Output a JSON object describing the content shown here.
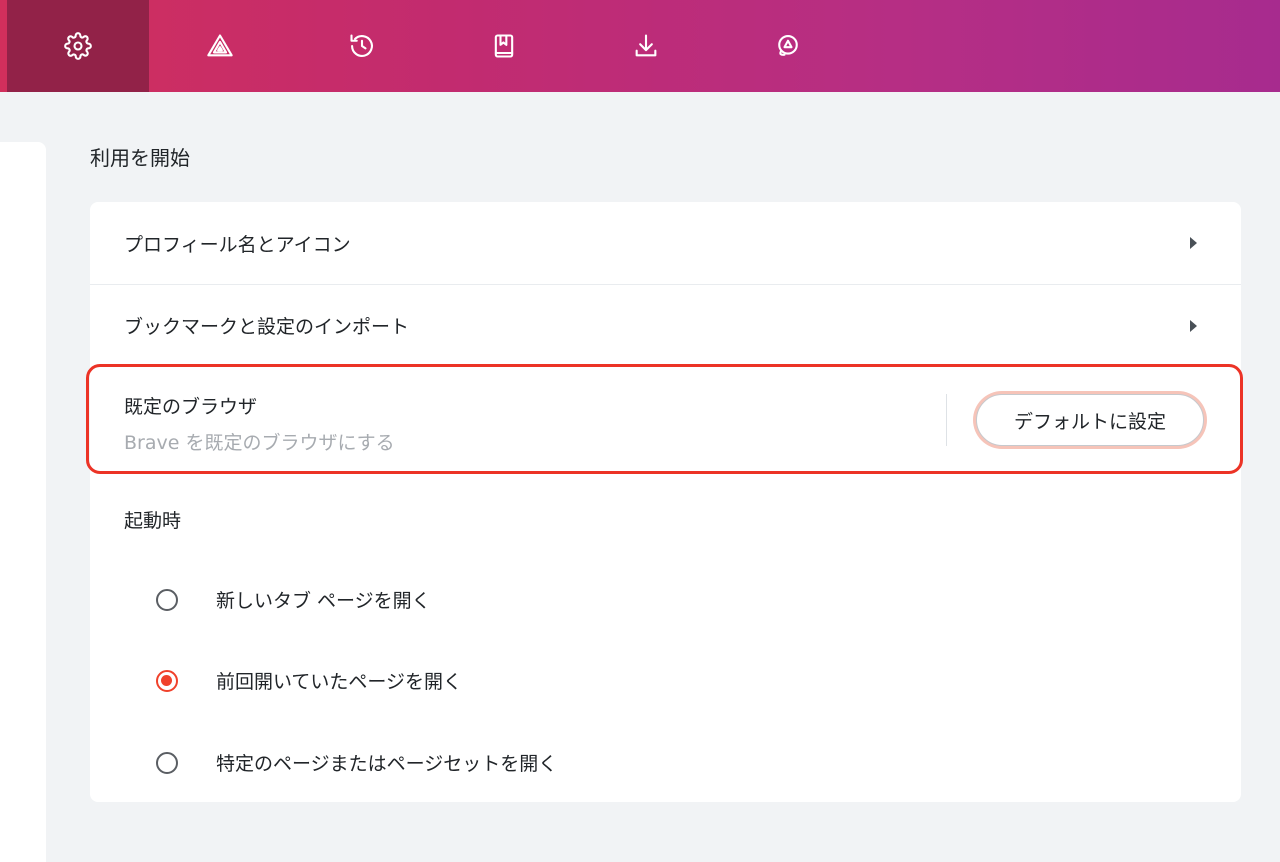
{
  "nav": {
    "items": [
      {
        "icon": "gear-icon",
        "active": true
      },
      {
        "icon": "brave-rewards-icon",
        "active": false
      },
      {
        "icon": "history-icon",
        "active": false
      },
      {
        "icon": "bookmarks-icon",
        "active": false
      },
      {
        "icon": "download-icon",
        "active": false
      },
      {
        "icon": "brave-wallet-icon",
        "active": false
      }
    ]
  },
  "colors": {
    "accent": "#f0412b",
    "highlight": "#ec3326",
    "active_tab": "#922248"
  },
  "get_started": {
    "heading": "利用を開始",
    "profile_label": "プロフィール名とアイコン",
    "import_label": "ブックマークと設定のインポート",
    "default_browser_title": "既定のブラウザ",
    "default_browser_sub": "Brave を既定のブラウザにする",
    "default_button": "デフォルトに設定"
  },
  "startup": {
    "label": "起動時",
    "options": [
      {
        "label": "新しいタブ ページを開く",
        "checked": false
      },
      {
        "label": "前回開いていたページを開く",
        "checked": true
      },
      {
        "label": "特定のページまたはページセットを開く",
        "checked": false
      }
    ]
  }
}
